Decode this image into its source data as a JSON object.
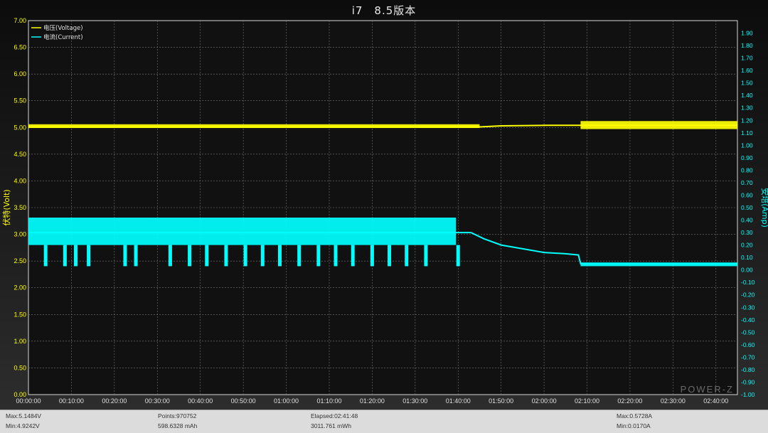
{
  "title": "i7　8.5版本",
  "watermark": "POWER-Z",
  "chart_data": {
    "type": "line",
    "left_axis": {
      "label": "伏特(Volt)",
      "min": 0,
      "max": 7,
      "step": 0.5,
      "color": "#ffff00"
    },
    "right_axis": {
      "label": "安培(Amp)",
      "min": -1.0,
      "max": 2.0,
      "step": 0.1,
      "color": "#00ffff"
    },
    "x_axis": {
      "min_minutes": 0,
      "max_minutes": 165,
      "step_minutes": 10,
      "tick_labels": [
        "00:00:00",
        "00:10:00",
        "00:20:00",
        "00:30:00",
        "00:40:00",
        "00:50:00",
        "01:00:00",
        "01:10:00",
        "01:20:00",
        "01:30:00",
        "01:40:00",
        "01:50:00",
        "02:00:00",
        "02:10:00",
        "02:20:00",
        "02:30:00",
        "02:40:00"
      ]
    },
    "grid": true,
    "legend_placement": "top-left",
    "series": [
      {
        "name": "电压(Voltage)",
        "axis": "left",
        "color": "#ffff00",
        "points": [
          [
            0,
            5.01
          ],
          [
            10,
            5.01
          ],
          [
            20,
            5.01
          ],
          [
            30,
            5.01
          ],
          [
            40,
            5.01
          ],
          [
            50,
            5.01
          ],
          [
            60,
            5.01
          ],
          [
            70,
            5.01
          ],
          [
            80,
            5.01
          ],
          [
            90,
            5.01
          ],
          [
            100,
            5.01
          ],
          [
            105,
            5.01
          ],
          [
            110,
            5.03
          ],
          [
            120,
            5.04
          ],
          [
            128,
            5.04
          ],
          [
            128.5,
            5.04
          ],
          [
            165,
            5.04
          ]
        ],
        "bands": [
          [
            0,
            105,
            4.99,
            5.06
          ],
          [
            128.5,
            165,
            4.97,
            5.12
          ]
        ]
      },
      {
        "name": "电流(Current)",
        "axis": "right",
        "color": "#00ffff",
        "points": [
          [
            0,
            0.3
          ],
          [
            10,
            0.3
          ],
          [
            20,
            0.3
          ],
          [
            30,
            0.3
          ],
          [
            40,
            0.3
          ],
          [
            50,
            0.3
          ],
          [
            60,
            0.3
          ],
          [
            70,
            0.3
          ],
          [
            80,
            0.3
          ],
          [
            90,
            0.3
          ],
          [
            99.5,
            0.3
          ],
          [
            100,
            0.3
          ],
          [
            103,
            0.3
          ],
          [
            106,
            0.25
          ],
          [
            110,
            0.2
          ],
          [
            115,
            0.17
          ],
          [
            120,
            0.14
          ],
          [
            125,
            0.13
          ],
          [
            128,
            0.12
          ],
          [
            128.5,
            0.05
          ],
          [
            165,
            0.05
          ]
        ],
        "bands": [
          [
            0,
            99.5,
            0.2,
            0.42
          ],
          [
            128.5,
            165,
            0.03,
            0.06
          ]
        ]
      }
    ],
    "current_dips_minutes": [
      4,
      8.5,
      11,
      14,
      22.5,
      25,
      33,
      37.5,
      41.5,
      46,
      50.5,
      54.5,
      58.5,
      63,
      67.5,
      71.5,
      75.5,
      80,
      84,
      88,
      92.5,
      100
    ]
  },
  "footer": {
    "max_voltage": "Max:5.1484V",
    "min_voltage": "Min:4.9242V",
    "points": "Points:970752",
    "capacity": "598.6328 mAh",
    "elapsed": "Elapsed:02:41:48",
    "energy": "3011.761 mWh",
    "max_current": "Max:0.5728A",
    "min_current": "Min:0.0170A"
  }
}
